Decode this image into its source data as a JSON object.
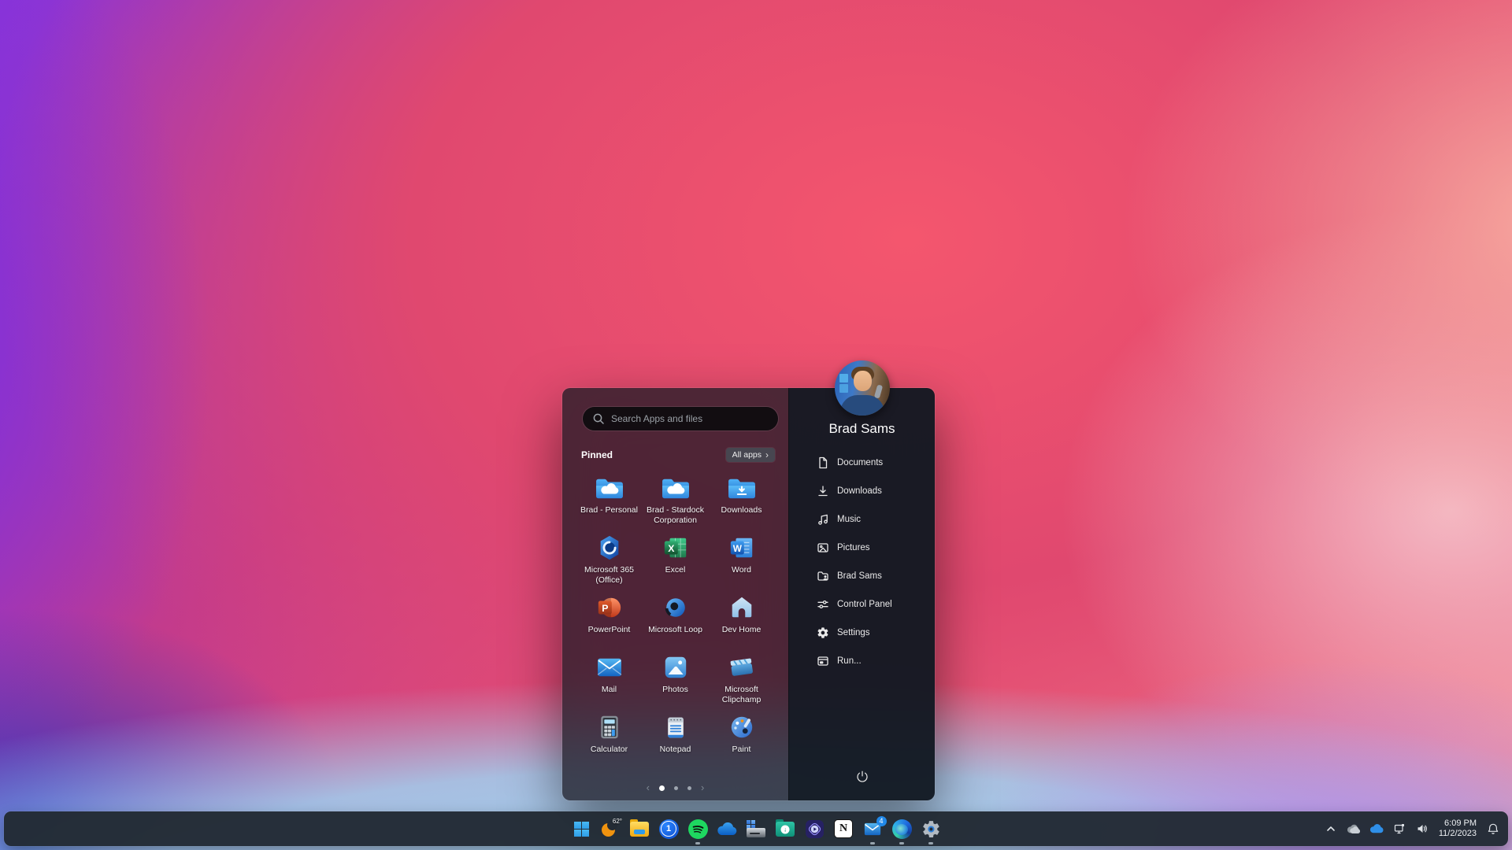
{
  "colors": {
    "menu_left_bg": "rgba(30,29,38,0.78)",
    "menu_right_bg": "rgba(17,24,33,0.96)",
    "taskbar_bg": "rgba(34,42,52,0.97)",
    "accent": "#3db7f2"
  },
  "start_menu": {
    "search": {
      "placeholder": "Search Apps and files"
    },
    "pinned_label": "Pinned",
    "all_apps_label": "All apps",
    "apps": [
      {
        "label": "Brad - Personal",
        "icon": "onedrive-folder"
      },
      {
        "label": "Brad - Stardock Corporation",
        "icon": "onedrive-folder"
      },
      {
        "label": "Downloads",
        "icon": "downloads-folder"
      },
      {
        "label": "Microsoft 365 (Office)",
        "icon": "microsoft-365"
      },
      {
        "label": "Excel",
        "icon": "excel"
      },
      {
        "label": "Word",
        "icon": "word"
      },
      {
        "label": "PowerPoint",
        "icon": "powerpoint"
      },
      {
        "label": "Microsoft Loop",
        "icon": "loop"
      },
      {
        "label": "Dev Home",
        "icon": "dev-home"
      },
      {
        "label": "Mail",
        "icon": "mail"
      },
      {
        "label": "Photos",
        "icon": "photos"
      },
      {
        "label": "Microsoft Clipchamp",
        "icon": "clipchamp"
      },
      {
        "label": "Calculator",
        "icon": "calculator"
      },
      {
        "label": "Notepad",
        "icon": "notepad"
      },
      {
        "label": "Paint",
        "icon": "paint"
      }
    ],
    "pagination": {
      "pages": 3,
      "active_page": 1
    },
    "user": {
      "name": "Brad Sams"
    },
    "links": [
      {
        "label": "Documents",
        "icon": "document"
      },
      {
        "label": "Downloads",
        "icon": "download"
      },
      {
        "label": "Music",
        "icon": "music"
      },
      {
        "label": "Pictures",
        "icon": "pictures"
      },
      {
        "label": "Brad Sams",
        "icon": "user-folder"
      },
      {
        "label": "Control Panel",
        "icon": "sliders"
      },
      {
        "label": "Settings",
        "icon": "gear"
      },
      {
        "label": "Run...",
        "icon": "run"
      }
    ]
  },
  "taskbar": {
    "weather_temp": "62°",
    "mail_badge": "4",
    "items": [
      {
        "name": "start",
        "running": false
      },
      {
        "name": "weather",
        "running": false
      },
      {
        "name": "file-explorer",
        "running": false
      },
      {
        "name": "1password",
        "running": false
      },
      {
        "name": "spotify",
        "running": true
      },
      {
        "name": "onedrive",
        "running": false
      },
      {
        "name": "this-pc",
        "running": false
      },
      {
        "name": "downloads-folder",
        "running": false
      },
      {
        "name": "video-app",
        "running": false
      },
      {
        "name": "notion",
        "running": false
      },
      {
        "name": "mail",
        "running": true
      },
      {
        "name": "edge",
        "running": true
      },
      {
        "name": "settings",
        "running": true
      }
    ],
    "tray": {
      "time": "6:09 PM",
      "date": "11/2/2023"
    }
  }
}
